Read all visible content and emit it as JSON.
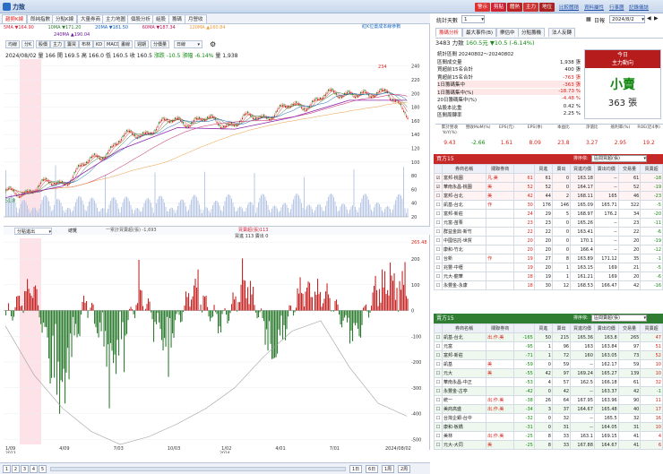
{
  "app": {
    "title": "力致"
  },
  "titlebar_buttons": [
    "警示",
    "剪貼",
    "體熱",
    "主力",
    "地位"
  ],
  "titlebar_links": [
    "比較體積",
    "資料屬性",
    "行事曆",
    "記錄儀誌"
  ],
  "left_tabs": [
    "趨勢K線",
    "郎純指數",
    "分點K線",
    "大量券商",
    "主力地圖",
    "個股分析",
    "組股",
    "籌碼",
    "月營收"
  ],
  "chart": {
    "legend_top": [
      {
        "label": "5MA ▼164.90",
        "color": "#d7263d"
      },
      {
        "label": "10MA ▼171.20",
        "color": "#2e7d32"
      },
      {
        "label": "20MA ▼181.50",
        "color": "#1565c0"
      },
      {
        "label": "60MA ▼187.34",
        "color": "#c2185b"
      },
      {
        "label": "120MA ▲160.84",
        "color": "#ef9a3a"
      }
    ],
    "legend_right": "紅K位置成本線參數",
    "legend_second": "240MA ▲190.04",
    "toolbar": [
      "均線",
      "分K",
      "股價",
      "主力",
      "籌買",
      "布林",
      "KD",
      "MACD",
      "畫線",
      "週期",
      "分價量"
    ],
    "period_select": "日線",
    "ohlc_line": {
      "date": "2024/08/02",
      "prefix": "量 166",
      "open": "開 169.5",
      "high": "高 166.0",
      "low": "低 160.5",
      "close": "收 160.5",
      "change_label": "漲跌",
      "change": "-10.5",
      "pct_label": "漲幅",
      "pct": "-6.14%",
      "vol_label": "量",
      "vol": "1,938"
    },
    "peak_label": "234",
    "low_label": "51.8",
    "y_axis_price": [
      "240",
      "220",
      "200",
      "180",
      "160",
      "140",
      "120",
      "100",
      "80",
      "60",
      "40",
      "20"
    ],
    "y_axis_osc": [
      "265.48",
      "200",
      "100",
      "0",
      "-100",
      "-200",
      "-300",
      "-400",
      "-500"
    ],
    "x_axis": [
      "1/09",
      "4/09",
      "7/03",
      "10/03",
      "1/02",
      "4/01",
      "7/01",
      "2024/08/02"
    ],
    "x_axis_years": [
      "2023",
      "2024"
    ],
    "lower_select": "分點進出",
    "lower_tab": "總覽",
    "lower_legend": [
      {
        "label": "一累計買賣超(張) -1,693",
        "color": "#666"
      },
      {
        "label": "買賣超(張)113",
        "color": "#d7263d"
      }
    ],
    "lower_legend2": "買進 113 賣出 0",
    "bottom_pages": [
      "1",
      "2",
      "3",
      "4",
      "5"
    ],
    "bottom_zoom": [
      "1日",
      "6日",
      "1周",
      "2周"
    ]
  },
  "chart_data": [
    {
      "type": "line",
      "title": "",
      "xlabel": "",
      "ylabel": "",
      "ylim": [
        20,
        250
      ],
      "x": [
        "2023/01/09",
        "2023/04/09",
        "2023/07/03",
        "2023/10/03",
        "2024/01/02",
        "2024/04/01",
        "2024/07/01",
        "2024/08/02"
      ],
      "series": [
        {
          "name": "",
          "values": [
            52,
            72,
            132,
            162,
            157,
            180,
            205,
            160.5
          ]
        },
        {
          "name": "",
          "values": [
            48,
            65,
            118,
            150,
            148,
            165,
            190,
            190
          ]
        }
      ]
    },
    {
      "type": "bar",
      "ylim": [
        -520,
        280
      ],
      "series": [
        {
          "name": "買賣超(張)",
          "values": [
            -40,
            120,
            -380,
            60,
            -250,
            90,
            -160,
            110,
            -70,
            140,
            -210,
            100,
            70,
            -120,
            130,
            113
          ]
        },
        {
          "name": "一累計買賣超(張)",
          "values": [
            -60,
            -250,
            -380,
            -470,
            -520,
            -490,
            -440,
            -380,
            -300,
            -180,
            -80,
            -40,
            -220,
            -360,
            -410,
            -1693
          ]
        }
      ]
    }
  ],
  "right": {
    "stats_days_label": "統計天數",
    "stats_days": "1",
    "date_label": "日報",
    "date": "2024/8/2",
    "tabs": [
      "籌碼分析",
      "最大事件(B)",
      "樂估中",
      "分點籌機",
      "法人反轉"
    ],
    "stock_line": {
      "code": "3483 力致",
      "price": "160.5元",
      "chg": "▼10.5 (-6.14%)"
    },
    "stats": [
      {
        "k": "統計區間 20240802～20240802",
        "v": ""
      },
      {
        "k": "區間成交量",
        "v": "1,938 張"
      },
      {
        "k": "買超前15名合計",
        "v": "400 張"
      },
      {
        "k": "賣超前15名合計",
        "v": "-763 張"
      },
      {
        "k": "1日籌碼集中",
        "v": "-363 張"
      },
      {
        "k": "1日籌碼集中(%)",
        "v": "-18.73 %"
      },
      {
        "k": "20日籌碼集中(%)",
        "v": "-4.48 %"
      },
      {
        "k": "佔股本比重",
        "v": "0.42 %"
      },
      {
        "k": "區間周轉率",
        "v": "2.25 %"
      }
    ],
    "today_box": {
      "title": "今日",
      "subtitle": "主力動向",
      "big": "小賣",
      "amount": "363 張"
    },
    "metrics_headers": [
      "累計營收YoY(%)",
      "營收MoM(%)",
      "EPS(元)",
      "EPS(季)",
      "本益比",
      "淨值比",
      "殖利率(%)",
      "ROE(近4季)"
    ],
    "metrics_values": [
      "9.43",
      "-2.66",
      "1.61",
      "8.09",
      "23.8",
      "3.27",
      "2.95",
      "19.2"
    ],
    "buy_section": {
      "title": "買方15",
      "select_label": "排序依:",
      "select": "區間買超(張)"
    },
    "table_headers": [
      "券商名稱",
      "關聯券商",
      "買進",
      "賣出",
      "買進均價",
      "賣出均價",
      "交易量",
      "買賣超"
    ],
    "buy_rows": [
      [
        "富邦-桃園",
        "凡.美",
        "61",
        "61",
        "0",
        "163.18",
        "--",
        "61",
        "-18"
      ],
      [
        "華南永昌-桃園",
        "美",
        "52",
        "52",
        "0",
        "164.17",
        "--",
        "52",
        "-19"
      ],
      [
        "富邦-台北",
        "美",
        "42",
        "44",
        "2",
        "168.11",
        "165",
        "46",
        "-23"
      ],
      [
        "凱基-台北",
        "作",
        "30",
        "176",
        "146",
        "165.09",
        "165.71",
        "322",
        "-5"
      ],
      [
        "富邦-新莊",
        "",
        "24",
        "29",
        "5",
        "168.97",
        "176.2",
        "34",
        "-20"
      ],
      [
        "元富-苗栗",
        "",
        "23",
        "23",
        "0",
        "165.26",
        "--",
        "23",
        "-11"
      ],
      [
        "群益金鼎-新竹",
        "",
        "22",
        "22",
        "0",
        "163.41",
        "--",
        "22",
        "-6"
      ],
      [
        "中國信託-世貿",
        "",
        "20",
        "20",
        "0",
        "170.1",
        "--",
        "20",
        "-19"
      ],
      [
        "康和-竹北",
        "",
        "20",
        "20",
        "0",
        "166.4",
        "--",
        "20",
        "-12"
      ],
      [
        "台新",
        "作",
        "19",
        "27",
        "8",
        "163.89",
        "171.12",
        "35",
        "-1"
      ],
      [
        "兆豐-中壢",
        "",
        "19",
        "20",
        "1",
        "163.15",
        "169",
        "21",
        "-5"
      ],
      [
        "元大-龍華",
        "",
        "18",
        "19",
        "1",
        "161.21",
        "169",
        "20",
        "-6"
      ],
      [
        "永豐金-永康",
        "",
        "18",
        "30",
        "12",
        "168.53",
        "166.47",
        "42",
        "-16"
      ]
    ],
    "sell_section": {
      "title": "賣方15",
      "select_label": "排序依:",
      "select": "區間賣超(張)"
    },
    "sell_rows": [
      [
        "凱基-台北",
        "出.作.美",
        "-165",
        "50",
        "215",
        "165.36",
        "163.8",
        "265",
        "47"
      ],
      [
        "元富",
        "",
        "-95",
        "1",
        "96",
        "163",
        "163.84",
        "97",
        "51"
      ],
      [
        "富邦-新莊",
        "",
        "-71",
        "1",
        "72",
        "160",
        "163.05",
        "73",
        "52"
      ],
      [
        "凱基",
        "美",
        "-59",
        "0",
        "59",
        "--",
        "162.17",
        "59",
        "10"
      ],
      [
        "元大",
        "美",
        "-55",
        "42",
        "97",
        "169.24",
        "165.27",
        "139",
        "10"
      ],
      [
        "華南永昌-中正",
        "",
        "-53",
        "4",
        "57",
        "162.5",
        "166.18",
        "61",
        "32"
      ],
      [
        "永豐金-古亭",
        "",
        "-42",
        "0",
        "42",
        "--",
        "163.37",
        "42",
        "-1"
      ],
      [
        "統一",
        "出.作.美",
        "-38",
        "26",
        "64",
        "167.95",
        "163.96",
        "90",
        "11"
      ],
      [
        "美商高盛",
        "出.作.美",
        "-34",
        "3",
        "37",
        "164.67",
        "165.48",
        "40",
        "17"
      ],
      [
        "台灣企銀-台中",
        "",
        "-32",
        "0",
        "32",
        "--",
        "165.5",
        "32",
        "16"
      ],
      [
        "康和-板橋",
        "",
        "-31",
        "0",
        "31",
        "--",
        "164.05",
        "31",
        "10"
      ],
      [
        "美林",
        "出.作.美",
        "-25",
        "8",
        "33",
        "163.1",
        "169.15",
        "41",
        "4"
      ],
      [
        "元大-大同",
        "美",
        "-25",
        "8",
        "33",
        "167.88",
        "164.67",
        "41",
        "6"
      ]
    ]
  },
  "colors": {
    "up": "#d9241c",
    "down": "#138a12",
    "accent": "#2b6cc4",
    "buy_bar": "#c62828",
    "sell_bar": "#2e7d32"
  }
}
